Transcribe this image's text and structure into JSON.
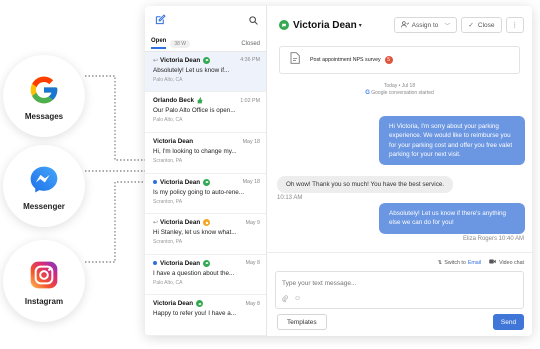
{
  "channels": [
    {
      "label": "Messages",
      "icon": "google-icon"
    },
    {
      "label": "Messenger",
      "icon": "messenger-icon"
    },
    {
      "label": "Instagram",
      "icon": "instagram-icon"
    }
  ],
  "sidebar": {
    "tabs": {
      "open": "Open",
      "open_count": "38 W",
      "closed": "Closed"
    },
    "conversations": [
      {
        "name": "Victoria Dean",
        "time": "4:36 PM",
        "preview": "Absolutely! Let us know if...",
        "location": "Palo Alto, CA",
        "channel": "google",
        "replied": true,
        "unread": false
      },
      {
        "name": "Orlando Beck",
        "time": "1:02 PM",
        "preview": "Our Palo Alto Office is open...",
        "location": "Palo Alto, CA",
        "channel": "thumb",
        "replied": false,
        "unread": false
      },
      {
        "name": "Victoria Dean",
        "time": "May 18",
        "preview": "Hi, I'm looking to change my...",
        "location": "Scranton, PA",
        "channel": "none",
        "replied": false,
        "unread": false
      },
      {
        "name": "Victoria Dean",
        "time": "May 18",
        "preview": "Is my policy going to auto-rene...",
        "location": "Scranton, PA",
        "channel": "google",
        "replied": false,
        "unread": true
      },
      {
        "name": "Victoria Dean",
        "time": "May 9",
        "preview": "Hi Stanley, let us know what...",
        "location": "Scranton, PA",
        "channel": "orange",
        "replied": true,
        "unread": false
      },
      {
        "name": "Victoria Dean",
        "time": "May 8",
        "preview": "I have a question about the...",
        "location": "Palo Alto, CA",
        "channel": "google",
        "replied": false,
        "unread": true
      },
      {
        "name": "Victoria Dean",
        "time": "May 8",
        "preview": "Happy to refer you! I have a...",
        "location": "",
        "channel": "google",
        "replied": false,
        "unread": false
      }
    ]
  },
  "header": {
    "contact_name": "Victoria Dean",
    "assign_label": "Assign to",
    "close_label": "Close"
  },
  "thread": {
    "survey_text": "Post appointment NPS survey",
    "survey_count": "5",
    "date_label": "Today • Jul 18",
    "started_label": "Google conversation started",
    "msg1": "Hi Victoria, I'm sorry about your parking experience. We would like to reimburse you for your parking cost and offer you free valet parking for your next visit.",
    "msg2": "Oh wow! Thank you so much! You have the best service.",
    "msg2_time": "10:13 AM",
    "msg3": "Absolutely! Let us know if there's anything else we can do for you!",
    "msg3_meta": "Eliza Rogers 10:40 AM"
  },
  "composer": {
    "switch_prefix": "Switch to",
    "switch_link": "Email",
    "video_label": "Video chat",
    "placeholder": "Type your text message...",
    "templates_label": "Templates",
    "send_label": "Send"
  },
  "colors": {
    "accent": "#3f76d8",
    "bubble_out": "#6b96e1",
    "google_green": "#34a853",
    "badge_red": "#e0533d"
  }
}
